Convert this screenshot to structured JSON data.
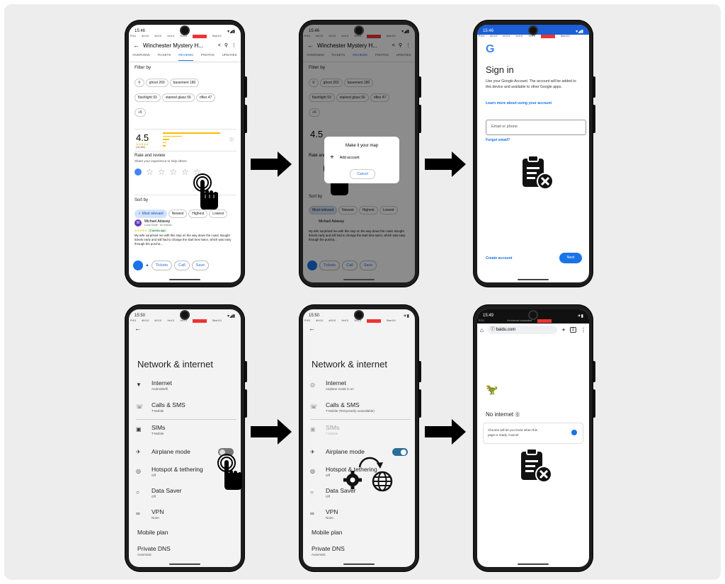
{
  "p1": {
    "time": "15:46",
    "title": "Winchester Mystery H...",
    "tabs": [
      "OVERVIEW",
      "TICKETS",
      "REVIEWS",
      "PHOTOS",
      "UPDATES"
    ],
    "filter_title": "Filter by",
    "chips_row1": [
      "ghost 260",
      "basement 180"
    ],
    "chips_row2": [
      "flashlight 93",
      "stained glass 56",
      "rifles 47"
    ],
    "chips_more": "+5",
    "rating": "4.5",
    "rating_count": "(16,360)",
    "rate_title": "Rate and review",
    "rate_sub": "Share your experience to help others",
    "sort_title": "Sort by",
    "sort_chips": [
      "Most relevant",
      "Newest",
      "Highest",
      "Lowest"
    ],
    "reviewer_name": "Michael Adaway",
    "reviewer_sub": "Local Guide · 60 reviews",
    "review_time": "2 weeks ago",
    "review_text": "My wife surprised me with this stop on the way down the coast. Bought tickets early and still had to change the start time twice, which was easy through the purcha...",
    "more": "more",
    "bottom_actions": [
      "Tickets",
      "Call",
      "Save"
    ]
  },
  "p2": {
    "time": "15:46",
    "dialog_title": "Make it your map",
    "dialog_item": "Add account",
    "dialog_cancel": "Cancel"
  },
  "p3": {
    "time": "15:46",
    "heading": "Sign in",
    "body": "Use your Google Account. The account will be added to this device and available to other Google apps.",
    "link": "Learn more about using your account",
    "email_placeholder": "Email or phone",
    "forgot": "Forgot email?",
    "create": "Create account",
    "next": "Next"
  },
  "p4": {
    "time": "15:50",
    "heading": "Network & internet",
    "items": [
      {
        "title": "Internet",
        "sub": "AndroidWifi"
      },
      {
        "title": "Calls & SMS",
        "sub": "T-Mobile"
      },
      {
        "title": "SIMs",
        "sub": "T-Mobile"
      },
      {
        "title": "Airplane mode",
        "sub": ""
      },
      {
        "title": "Hotspot & tethering",
        "sub": "Off"
      },
      {
        "title": "Data Saver",
        "sub": "Off"
      },
      {
        "title": "VPN",
        "sub": "None"
      },
      {
        "title": "Mobile plan",
        "sub": ""
      },
      {
        "title": "Private DNS",
        "sub": "Automatic"
      }
    ]
  },
  "p5": {
    "time": "15:50",
    "heading": "Network & internet",
    "items": [
      {
        "title": "Internet",
        "sub": "Airplane mode is on"
      },
      {
        "title": "Calls & SMS",
        "sub": "T-Mobile (Temporarily unavailable)"
      },
      {
        "title": "SIMs",
        "sub": "T-Mobile"
      },
      {
        "title": "Airplane mode",
        "sub": ""
      },
      {
        "title": "Hotspot & tethering",
        "sub": "Off"
      },
      {
        "title": "Data Saver",
        "sub": "Off"
      },
      {
        "title": "VPN",
        "sub": "None"
      },
      {
        "title": "Mobile plan",
        "sub": ""
      },
      {
        "title": "Private DNS",
        "sub": "Automatic"
      }
    ]
  },
  "p6": {
    "time": "15:49",
    "url": "baidu.com",
    "banner": "No internet connection",
    "heading": "No internet",
    "notice": "Chrome will let you know when this page is ready. Cancel"
  },
  "colors": {
    "accent": "#1a73e8",
    "star": "#fbbc04",
    "toggle_on": "#2a6f97",
    "error_red": "#e53935"
  }
}
